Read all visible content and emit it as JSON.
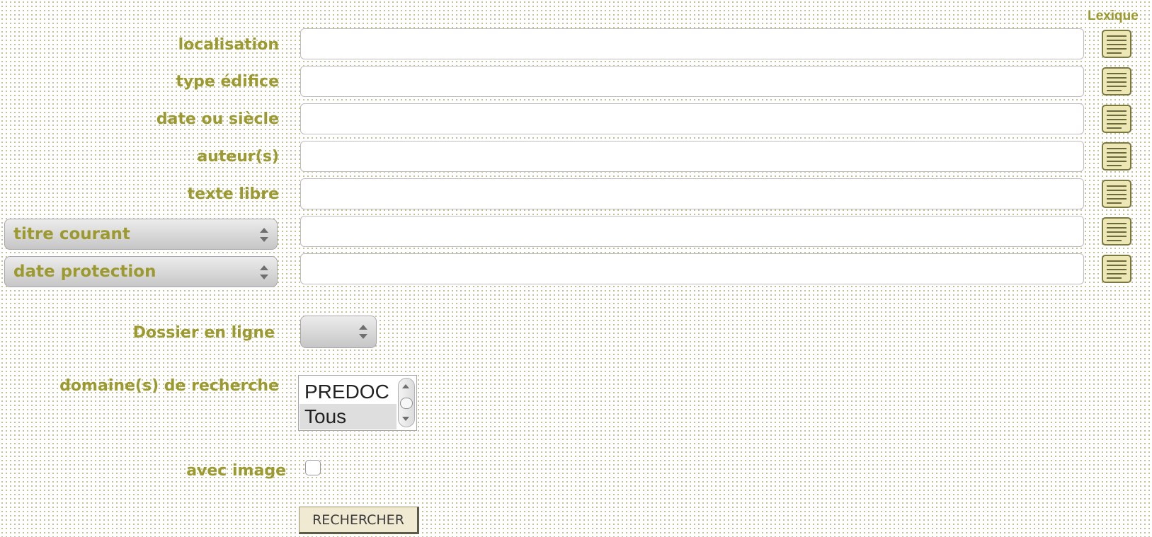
{
  "lexique_header": "Lexique",
  "fields": [
    {
      "label": "localisation",
      "value": ""
    },
    {
      "label": "type édifice",
      "value": ""
    },
    {
      "label": "date ou siècle",
      "value": ""
    },
    {
      "label": "auteur(s)",
      "value": ""
    },
    {
      "label": "texte libre",
      "value": ""
    },
    {
      "label": "titre courant",
      "value": "",
      "label_is_select": true
    },
    {
      "label": "date protection",
      "value": "",
      "label_is_select": true
    }
  ],
  "dossier_en_ligne": {
    "label": "Dossier en ligne",
    "selected": ""
  },
  "domaines": {
    "label": "domaine(s) de recherche",
    "options": [
      "PREDOC",
      "Tous"
    ]
  },
  "avec_image": {
    "label": "avec image",
    "checked": false
  },
  "submit_label": "RECHERCHER",
  "icons": {
    "lexique": "notepad-list-icon"
  },
  "colors": {
    "label": "#9c9a2f",
    "background_dots": "#b9b58a"
  }
}
